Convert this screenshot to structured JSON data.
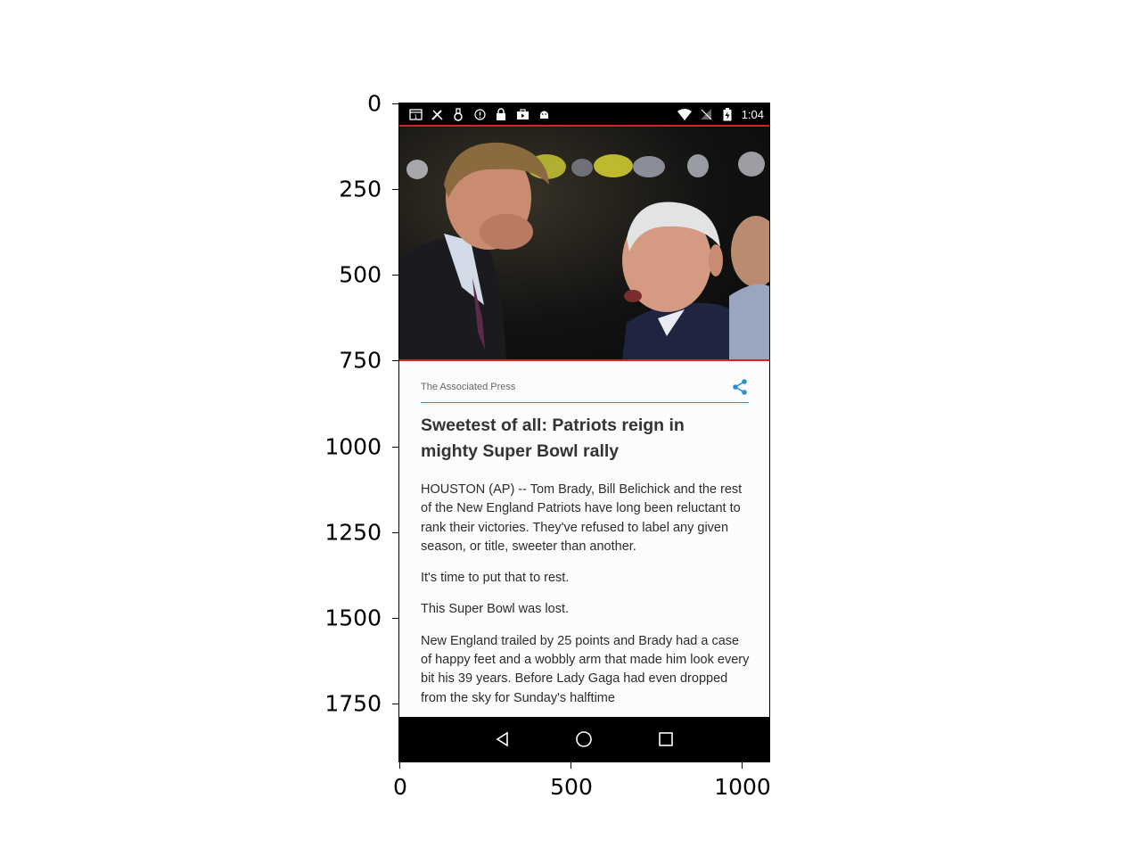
{
  "axes": {
    "y_ticks": [
      "0",
      "250",
      "500",
      "750",
      "1000",
      "1250",
      "1500",
      "1750"
    ],
    "x_ticks": [
      "0",
      "500",
      "1000"
    ]
  },
  "status_bar": {
    "time": "1:04",
    "left_icons": [
      "calendar-icon",
      "tools-icon",
      "clipboard-icon",
      "alert-icon",
      "lock-icon",
      "briefcase-icon",
      "android-icon"
    ],
    "right_icons": [
      "wifi-icon",
      "no-signal-icon",
      "battery-charging-icon"
    ]
  },
  "article": {
    "source": "The Associated Press",
    "headline": "Sweetest of all: Patriots reign in mighty Super Bowl rally",
    "paragraphs": [
      "HOUSTON (AP) -- Tom Brady, Bill Belichick and the rest of the New England Patriots have long been reluctant to rank their victories. They've refused to label any given season, or title, sweeter than another.",
      "It's time to put that to rest.",
      "This Super Bowl was lost.",
      "New England trailed by 25 points and Brady had a case of happy feet and a wobbly arm that made him look every bit his 39 years. Before Lady Gaga had even dropped from the sky for Sunday's halftime"
    ]
  },
  "colors": {
    "accent": "#2a8fd8",
    "hero_border": "#e02020"
  },
  "nav": {
    "buttons": [
      "back-icon",
      "home-icon",
      "recents-icon"
    ]
  }
}
